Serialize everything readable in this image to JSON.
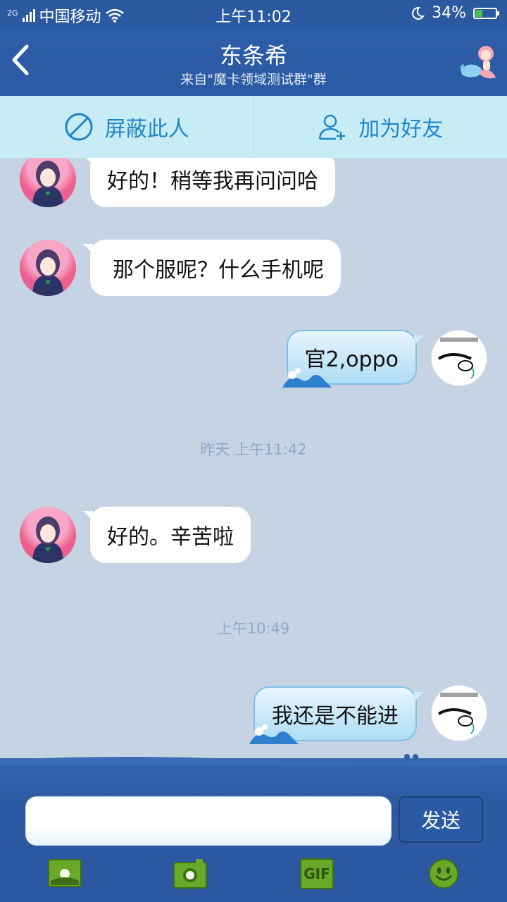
{
  "status_bar": {
    "network": "2G",
    "carrier": "中国移动",
    "time": "上午11:02",
    "battery": "34%",
    "battery_level": 0.34
  },
  "header": {
    "title": "东条希",
    "subtitle": "来自\"魔卡领域测试群\"群"
  },
  "actions": {
    "block_label": "屏蔽此人",
    "add_friend_label": "加为好友"
  },
  "messages": [
    {
      "side": "in",
      "text": "好的！稍等我再问问哈"
    },
    {
      "side": "in",
      "text": "那个服呢？什么手机呢"
    },
    {
      "side": "out",
      "text": "官2,oppo"
    },
    {
      "side": "in",
      "text": "好的。辛苦啦"
    },
    {
      "side": "out",
      "text": "我还是不能进"
    }
  ],
  "timestamps": [
    "昨天 上午11:42",
    "上午10:49"
  ],
  "composer": {
    "send_label": "发送",
    "gif_label": "GIF"
  },
  "colors": {
    "header_blue": "#2b5aa0",
    "action_bar": "#c7ecf5",
    "action_text": "#1f86c9",
    "chat_bg": "#c6d3e3",
    "tool_green": "#6aa82a"
  }
}
